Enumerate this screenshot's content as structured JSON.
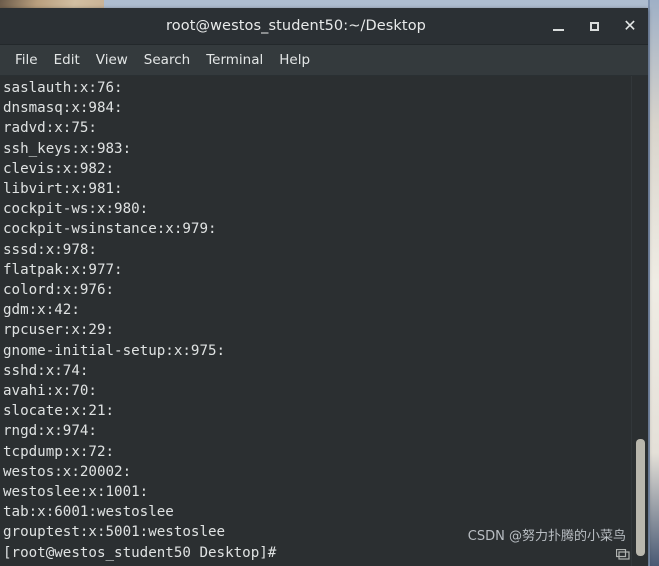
{
  "desktop": {
    "background_color": "#b8c4d4",
    "accent_tan": "#c9b295"
  },
  "window": {
    "title": "root@westos_student50:~/Desktop",
    "background_color": "#2b2f31",
    "titlebar_color": "#2b3034",
    "controls": [
      {
        "name": "minimize",
        "label": "–"
      },
      {
        "name": "maximize",
        "label": "□"
      },
      {
        "name": "close",
        "label": "✕"
      }
    ]
  },
  "menu": {
    "items": [
      {
        "label": "File"
      },
      {
        "label": "Edit"
      },
      {
        "label": "View"
      },
      {
        "label": "Search"
      },
      {
        "label": "Terminal"
      },
      {
        "label": "Help"
      }
    ]
  },
  "terminal": {
    "foreground_color": "#dfe2e2",
    "lines": [
      "saslauth:x:76:",
      "dnsmasq:x:984:",
      "radvd:x:75:",
      "ssh_keys:x:983:",
      "clevis:x:982:",
      "libvirt:x:981:",
      "cockpit-ws:x:980:",
      "cockpit-wsinstance:x:979:",
      "sssd:x:978:",
      "flatpak:x:977:",
      "colord:x:976:",
      "gdm:x:42:",
      "rpcuser:x:29:",
      "gnome-initial-setup:x:975:",
      "sshd:x:74:",
      "avahi:x:70:",
      "slocate:x:21:",
      "rngd:x:974:",
      "tcpdump:x:72:",
      "westos:x:20002:",
      "westoslee:x:1001:",
      "tab:x:6001:westoslee",
      "grouptest:x:5001:westoslee",
      "[root@westos_student50 Desktop]#"
    ]
  },
  "scrollbar": {
    "thumb_top_percent": 74,
    "thumb_height_percent": 24,
    "thumb_color": "#b9b7ad"
  },
  "watermark": {
    "text": "CSDN @努力扑腾的小菜鸟"
  }
}
